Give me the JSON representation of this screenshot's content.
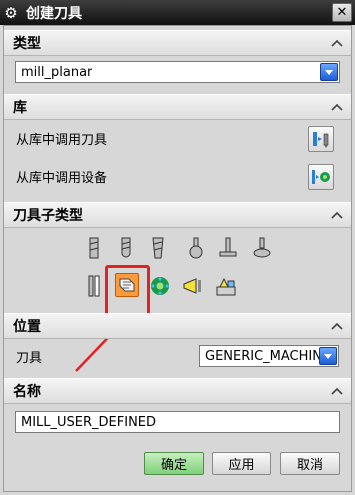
{
  "window": {
    "title": "创建刀具",
    "close_symbol": "✕"
  },
  "sections": {
    "type": {
      "label": "类型",
      "select_value": "mill_planar"
    },
    "library": {
      "label": "库",
      "call_tool_label": "从库中调用刀具",
      "call_device_label": "从库中调用设备"
    },
    "subtype": {
      "label": "刀具子类型",
      "icons": [
        "mill-end-icon",
        "ball-mill-icon",
        "tapered-mill-icon",
        "spherical-mill-icon",
        "t-cutter-icon",
        "barrel-cutter-icon",
        "thread-mill-icon",
        "mill-user-defined-icon",
        "carrier-icon",
        "head-icon",
        "tool-holder-icon"
      ],
      "selected_index": 7
    },
    "location": {
      "label": "位置",
      "tool_label": "刀具",
      "tool_value": "GENERIC_MACHINE"
    },
    "name": {
      "label": "名称",
      "value": "MILL_USER_DEFINED"
    }
  },
  "buttons": {
    "ok": "确定",
    "apply": "应用",
    "cancel": "取消"
  },
  "colors": {
    "selected_tool": "#ff9a3c",
    "highlight": "#e42222",
    "dropdown": "#1b5fd6",
    "ok_button": "#7fd07a"
  }
}
